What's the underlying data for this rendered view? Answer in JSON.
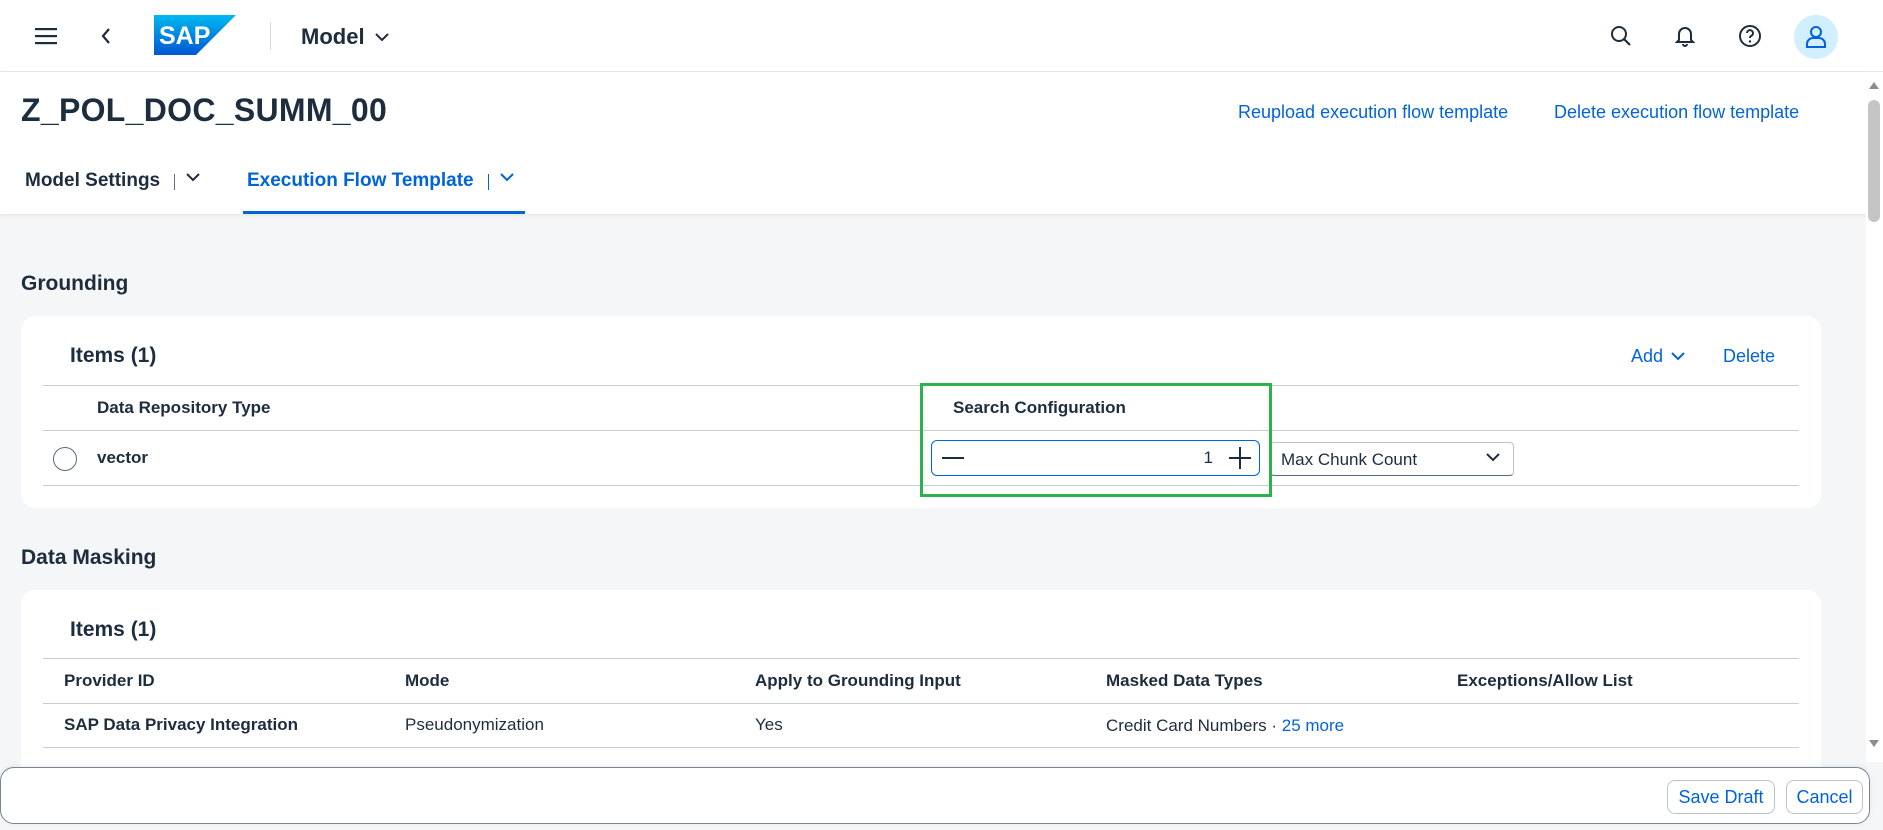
{
  "shell": {
    "logo_text": "SAP",
    "title": "Model",
    "icons": [
      "menu-icon",
      "back-icon",
      "search-icon",
      "bell-icon",
      "help-icon",
      "user-icon"
    ]
  },
  "header": {
    "object_title": "Z_POL_DOC_SUMM_00",
    "actions": {
      "reupload": "Reupload execution flow template",
      "delete": "Delete execution flow template"
    },
    "tabs": [
      {
        "label": "Model Settings",
        "active": false
      },
      {
        "label": "Execution Flow Template",
        "active": true
      }
    ]
  },
  "grounding": {
    "section_title": "Grounding",
    "items_title": "Items (1)",
    "add_label": "Add",
    "delete_label": "Delete",
    "columns": {
      "repo_type": "Data Repository Type",
      "search_config": "Search Configuration"
    },
    "rows": [
      {
        "repo_type": "vector",
        "stepper_value": "1",
        "config_option": "Max Chunk Count"
      }
    ]
  },
  "data_masking": {
    "section_title": "Data Masking",
    "items_title": "Items (1)",
    "columns": {
      "provider_id": "Provider ID",
      "mode": "Mode",
      "apply_grounding": "Apply to Grounding Input",
      "masked_types": "Masked Data Types",
      "exceptions": "Exceptions/Allow List"
    },
    "rows": [
      {
        "provider_id": "SAP Data Privacy Integration",
        "mode": "Pseudonymization",
        "apply_grounding": "Yes",
        "masked_types": "Credit Card Numbers ·",
        "more_link": "25 more",
        "exceptions": ""
      }
    ]
  },
  "footer": {
    "save_draft": "Save Draft",
    "cancel": "Cancel"
  },
  "colors": {
    "brand_blue": "#0064d9",
    "highlight_green": "#2db14c",
    "text_dark": "#1d2d3e"
  }
}
